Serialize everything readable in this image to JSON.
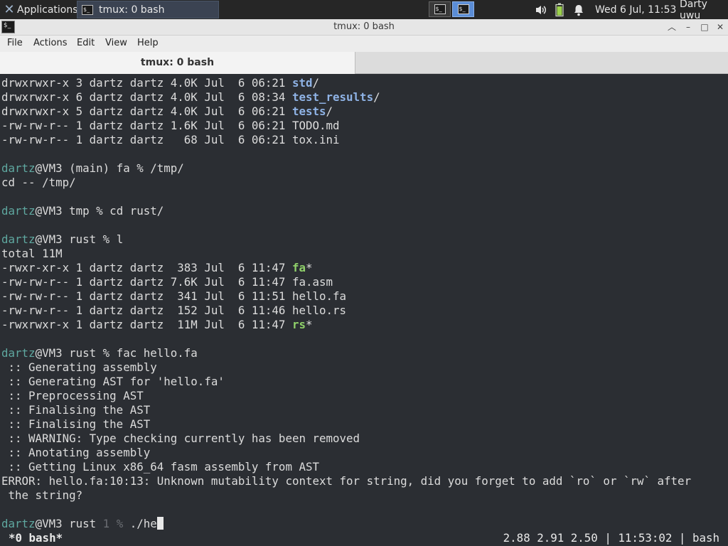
{
  "panel": {
    "apps_label": "Applications",
    "task_label": "tmux: 0 bash",
    "datetime": "Wed  6 Jul, 11:53",
    "user": "Darty uwu",
    "accent": "#5b8dd6"
  },
  "window": {
    "title": "tmux: 0 bash"
  },
  "menu": {
    "file": "File",
    "actions": "Actions",
    "edit": "Edit",
    "view": "View",
    "help": "Help"
  },
  "tab": {
    "label": "tmux: 0 bash"
  },
  "terminal": {
    "ls1": [
      {
        "meta": "drwxrwxr-x 3 dartz dartz 4.0K Jul  6 06:21 ",
        "name": "std",
        "suffix": "/",
        "kind": "dir"
      },
      {
        "meta": "drwxrwxr-x 6 dartz dartz 4.0K Jul  6 08:34 ",
        "name": "test_results",
        "suffix": "/",
        "kind": "dir"
      },
      {
        "meta": "drwxrwxr-x 5 dartz dartz 4.0K Jul  6 06:21 ",
        "name": "tests",
        "suffix": "/",
        "kind": "dir"
      },
      {
        "meta": "-rw-rw-r-- 1 dartz dartz 1.6K Jul  6 06:21 ",
        "name": "TODO.md",
        "suffix": "",
        "kind": "file"
      },
      {
        "meta": "-rw-rw-r-- 1 dartz dartz   68 Jul  6 06:21 ",
        "name": "tox.ini",
        "suffix": "",
        "kind": "file"
      }
    ],
    "prompt1_user": "dartz",
    "prompt1_rest": "@VM3 (main) fa % /tmp/",
    "cd_line": "cd -- /tmp/",
    "prompt2_user": "dartz",
    "prompt2_rest": "@VM3 tmp % cd rust/",
    "prompt3_user": "dartz",
    "prompt3_rest": "@VM3 rust % l",
    "total": "total 11M",
    "ls2": [
      {
        "meta": "-rwxr-xr-x 1 dartz dartz  383 Jul  6 11:47 ",
        "name": "fa",
        "suffix": "*",
        "kind": "exe"
      },
      {
        "meta": "-rw-rw-r-- 1 dartz dartz 7.6K Jul  6 11:47 ",
        "name": "fa.asm",
        "suffix": "",
        "kind": "file"
      },
      {
        "meta": "-rw-rw-r-- 1 dartz dartz  341 Jul  6 11:51 ",
        "name": "hello.fa",
        "suffix": "",
        "kind": "file"
      },
      {
        "meta": "-rw-rw-r-- 1 dartz dartz  152 Jul  6 11:46 ",
        "name": "hello.rs",
        "suffix": "",
        "kind": "file"
      },
      {
        "meta": "-rwxrwxr-x 1 dartz dartz  11M Jul  6 11:47 ",
        "name": "rs",
        "suffix": "*",
        "kind": "exe"
      }
    ],
    "prompt4_user": "dartz",
    "prompt4_rest": "@VM3 rust % fac hello.fa",
    "compile_output": [
      " :: Generating assembly",
      " :: Generating AST for 'hello.fa'",
      " :: Preprocessing AST",
      " :: Finalising the AST",
      " :: Finalising the AST",
      " :: WARNING: Type checking currently has been removed",
      " :: Anotating assembly",
      " :: Getting Linux x86_64 fasm assembly from AST"
    ],
    "error_line1": "ERROR: hello.fa:10:13: Unknown mutability context for string, did you forget to add `ro` or `rw` after",
    "error_line2": " the string?",
    "prompt5_user": "dartz",
    "prompt5_mid": "@VM3 rust ",
    "prompt5_status": "1 %",
    "prompt5_input": " ./he"
  },
  "status": {
    "left": "*0 bash*",
    "right": "2.88 2.91 2.50 | 11:53:02 | bash"
  },
  "colors": {
    "terminal_bg": "#2b2e33",
    "user": "#5fa8a0",
    "dir": "#8fb3e6",
    "exe": "#8fd06a"
  }
}
